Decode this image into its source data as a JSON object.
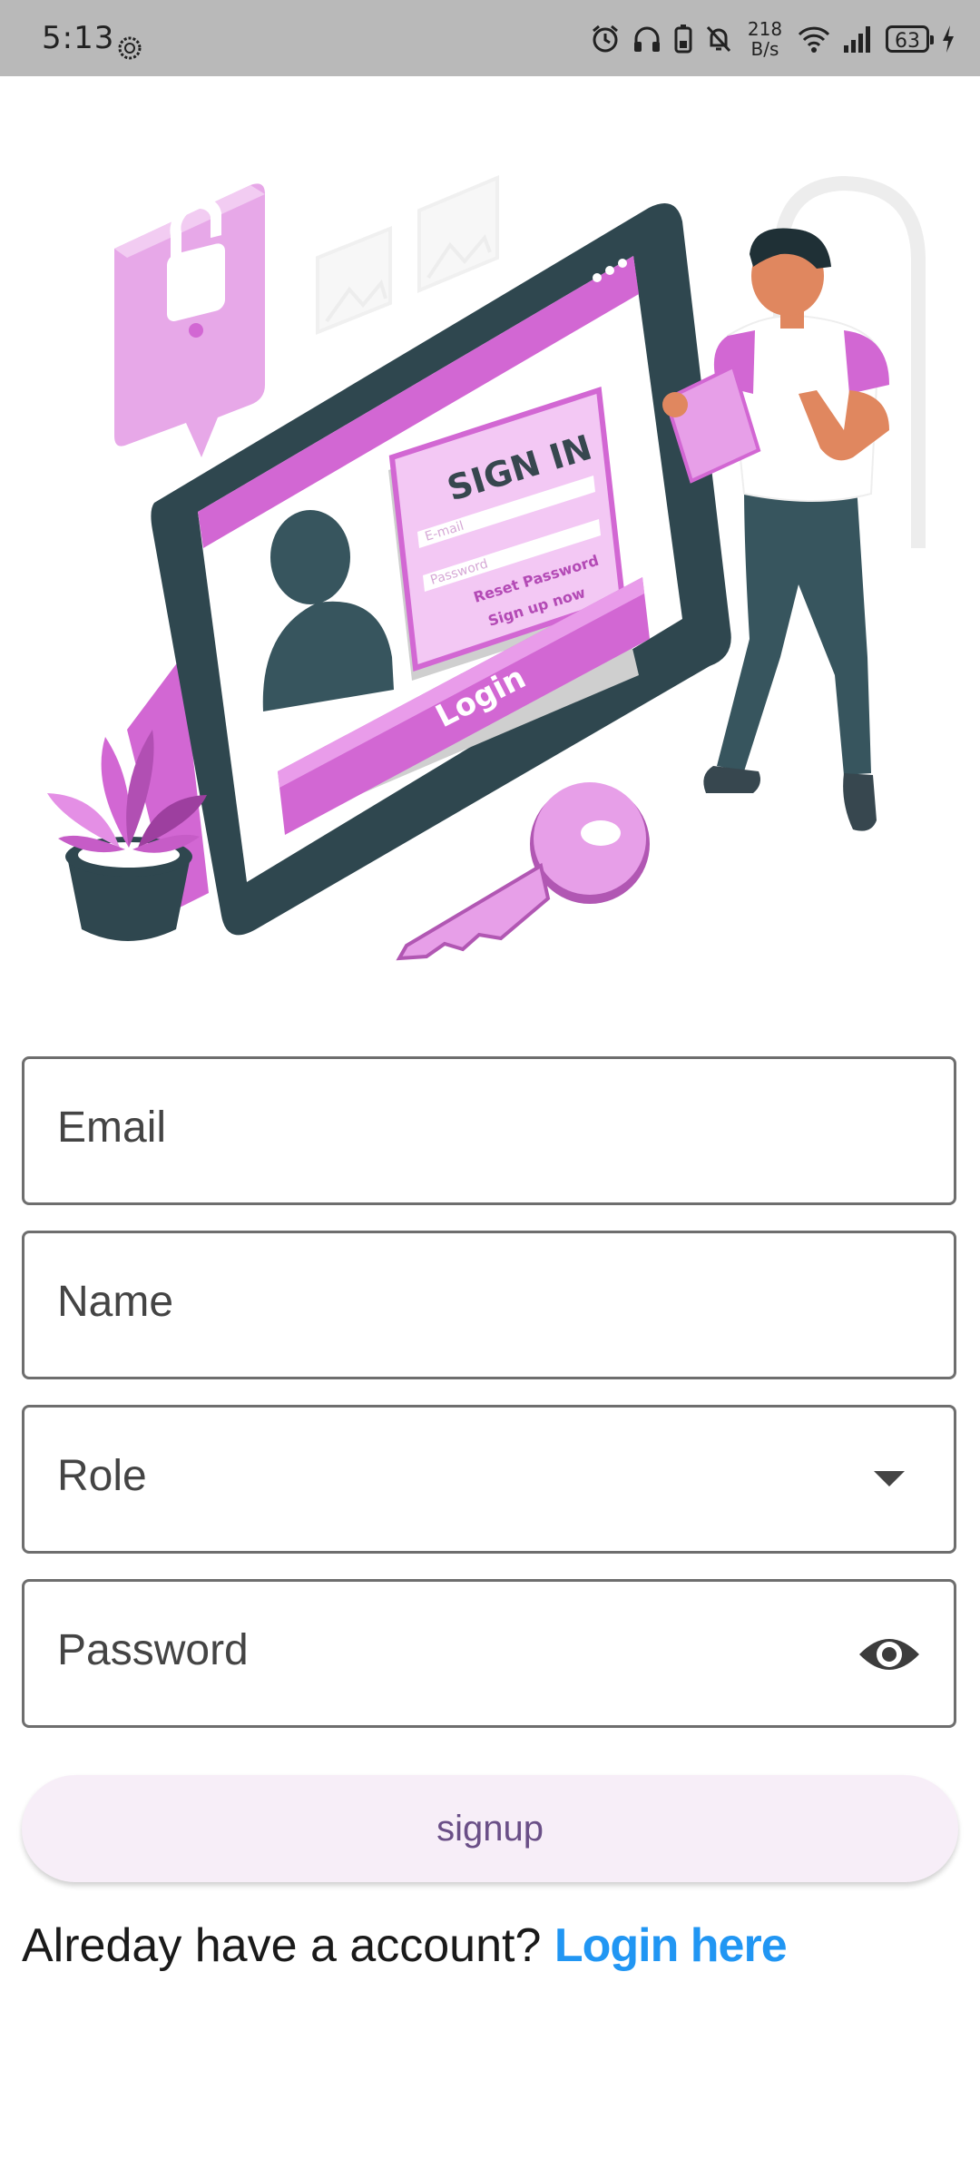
{
  "status_bar": {
    "time": "5:13",
    "net_speed_value": "218",
    "net_speed_unit": "B/s",
    "battery": "63"
  },
  "illustration": {
    "sign_in": "SIGN IN",
    "email_hint": "E-mail",
    "password_hint": "Password",
    "reset_password": "Reset Password",
    "sign_up_now": "Sign up now",
    "login": "Login"
  },
  "form": {
    "email_placeholder": "Email",
    "name_placeholder": "Name",
    "role_placeholder": "Role",
    "password_placeholder": "Password"
  },
  "signup_label": "signup",
  "footer": {
    "prompt": "Alreday have a account?",
    "login_link": "Login here"
  },
  "colors": {
    "accent_purple": "#d267d3",
    "dark_teal": "#37474f",
    "link_blue": "#2196f3",
    "button_bg": "#f7eef8"
  }
}
